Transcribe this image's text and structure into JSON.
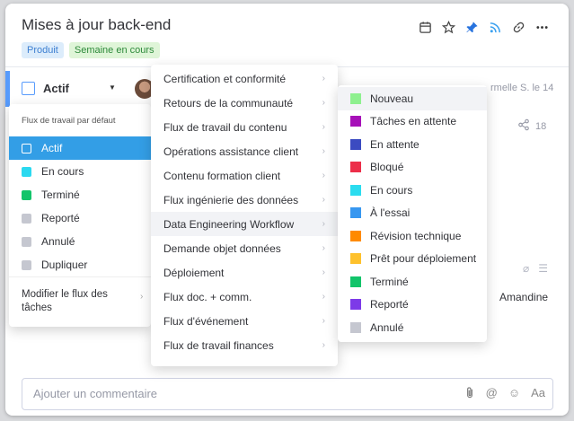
{
  "header": {
    "title": "Mises à jour back-end",
    "tags": [
      {
        "label": "Produit",
        "color": "#dcecfb"
      },
      {
        "label": "Semaine en cours",
        "color": "#dff5d8"
      }
    ],
    "toolbar_icons": [
      "calendar-icon",
      "star-icon",
      "pin-icon",
      "rss-icon",
      "link-icon",
      "more-icon"
    ]
  },
  "status": {
    "label": "Actif"
  },
  "background": {
    "updated_text": "rmelle S. le 14",
    "share_count": "18",
    "assignee": "Amandine"
  },
  "status_menu": {
    "header": "Flux de travail par défaut",
    "items": [
      {
        "label": "Actif",
        "color": "#339ee6",
        "selected": true
      },
      {
        "label": "En cours",
        "color": "#2bd9f0"
      },
      {
        "label": "Terminé",
        "color": "#12c46a"
      },
      {
        "label": "Reporté",
        "color": "#c5c7d0"
      },
      {
        "label": "Annulé",
        "color": "#c5c7d0"
      },
      {
        "label": "Dupliquer",
        "color": "#c5c7d0"
      }
    ],
    "modify_label": "Modifier le flux des tâches"
  },
  "workflow_menu": {
    "items": [
      "Certification et conformité",
      "Retours de la communauté",
      "Flux de travail du contenu",
      "Opérations assistance client",
      "Contenu formation client",
      "Flux ingénierie des données",
      "Data Engineering Workflow",
      "Demande objet données",
      "Déploiement",
      "Flux doc. + comm.",
      "Flux d'événement",
      "Flux de travail finances"
    ],
    "highlighted_index": 6
  },
  "submenu": {
    "items": [
      {
        "label": "Nouveau",
        "color": "#8ef08f"
      },
      {
        "label": "Tâches en attente",
        "color": "#a610b8"
      },
      {
        "label": "En attente",
        "color": "#3b4bc1"
      },
      {
        "label": "Bloqué",
        "color": "#ec2e49"
      },
      {
        "label": "En cours",
        "color": "#2bdcef"
      },
      {
        "label": "À l'essai",
        "color": "#3797f0"
      },
      {
        "label": "Révision technique",
        "color": "#ff8a00"
      },
      {
        "label": "Prêt pour déploiement",
        "color": "#fec12c"
      },
      {
        "label": "Terminé",
        "color": "#12c46a"
      },
      {
        "label": "Reporté",
        "color": "#7d3ae8"
      },
      {
        "label": "Annulé",
        "color": "#c5c7d0"
      }
    ]
  },
  "comment": {
    "placeholder": "Ajouter un commentaire",
    "icons": [
      "attach-icon",
      "mention-icon",
      "emoji-icon",
      "format-icon"
    ],
    "format_label": "Aa"
  }
}
